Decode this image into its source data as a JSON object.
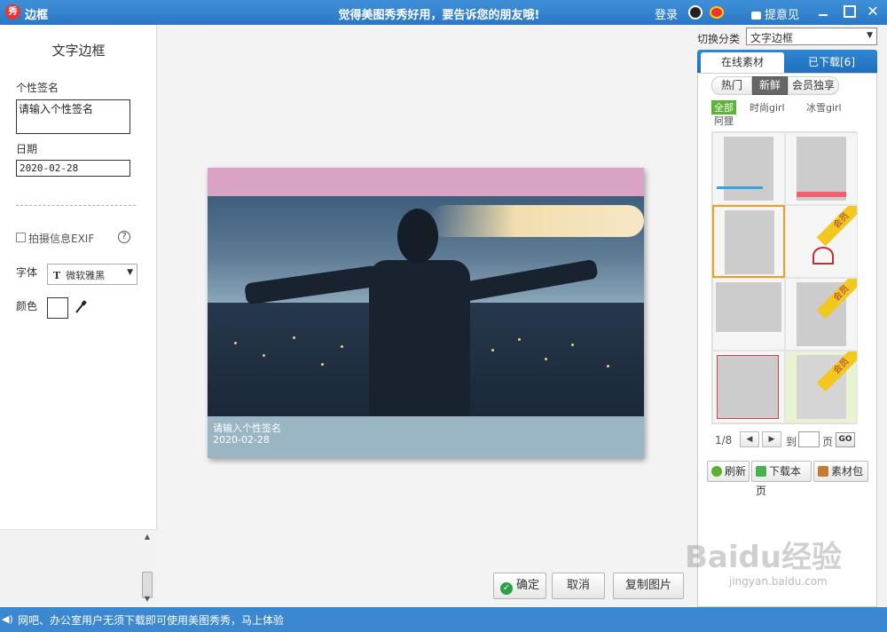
{
  "titlebar": {
    "app_title": "边框",
    "app_icon_text": "秀",
    "slogan": "觉得美图秀秀好用，要告诉您的朋友哦!",
    "login": "登录",
    "feedback": "提意见"
  },
  "left_panel": {
    "title": "文字边框",
    "signature_label": "个性签名",
    "signature_value": "请输入个性签名",
    "date_label": "日期",
    "date_value": "2020-02-28",
    "exif_label": "拍摄信息EXIF",
    "exif_checked": false,
    "help": "?",
    "font_label": "字体",
    "font_value": "微软雅黑",
    "color_label": "颜色",
    "color_value": "#ffffff"
  },
  "preview": {
    "caption_line1": "请输入个性签名",
    "caption_line2": "2020-02-28"
  },
  "actions": {
    "ok": "确定",
    "cancel": "取消",
    "copy": "复制图片"
  },
  "right_panel": {
    "category_label": "切换分类",
    "category_value": "文字边框",
    "tabs": [
      {
        "label": "在线素材",
        "active": true
      },
      {
        "label": "已下载[6]",
        "active": false
      }
    ],
    "pills": [
      {
        "label": "热门",
        "active": false
      },
      {
        "label": "新鲜",
        "active": true
      },
      {
        "label": "会员独享",
        "active": false
      }
    ],
    "filters": [
      "全部",
      "时尚girl",
      "冰雪girl",
      "阿狸"
    ],
    "vip_ribbon": "会员",
    "pager": {
      "current": "1/8",
      "to_label": "到",
      "page_label": "页",
      "go_label": "GO"
    },
    "buttons": {
      "refresh": "刷新",
      "download_page": "下载本页",
      "pack": "素材包"
    }
  },
  "statusbar": {
    "message": "网吧、办公室用户无须下载即可使用美图秀秀，马上体验"
  },
  "watermark": {
    "text": "Baidu经验",
    "sub": "jingyan.baidu.com"
  }
}
